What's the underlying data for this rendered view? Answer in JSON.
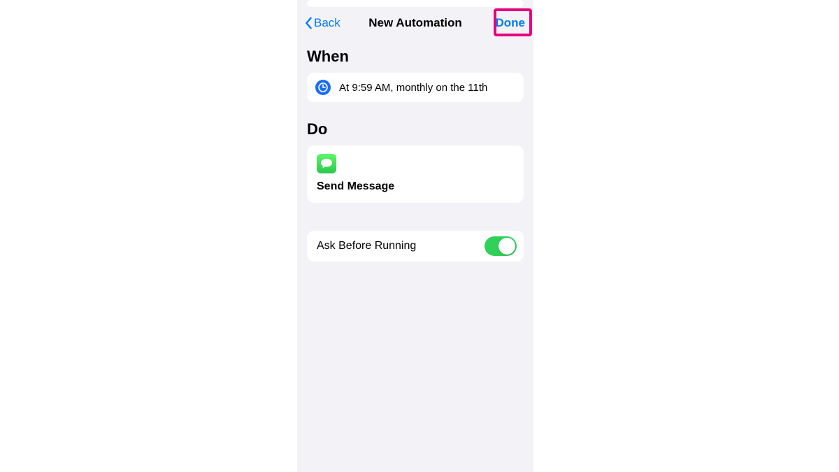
{
  "nav": {
    "back_label": "Back",
    "title": "New Automation",
    "done_label": "Done"
  },
  "sections": {
    "when_header": "When",
    "do_header": "Do"
  },
  "trigger": {
    "description": "At 9:59 AM, monthly on the 11th"
  },
  "action": {
    "title": "Send Message"
  },
  "settings": {
    "ask_before_running_label": "Ask Before Running",
    "ask_before_running_on": true
  }
}
